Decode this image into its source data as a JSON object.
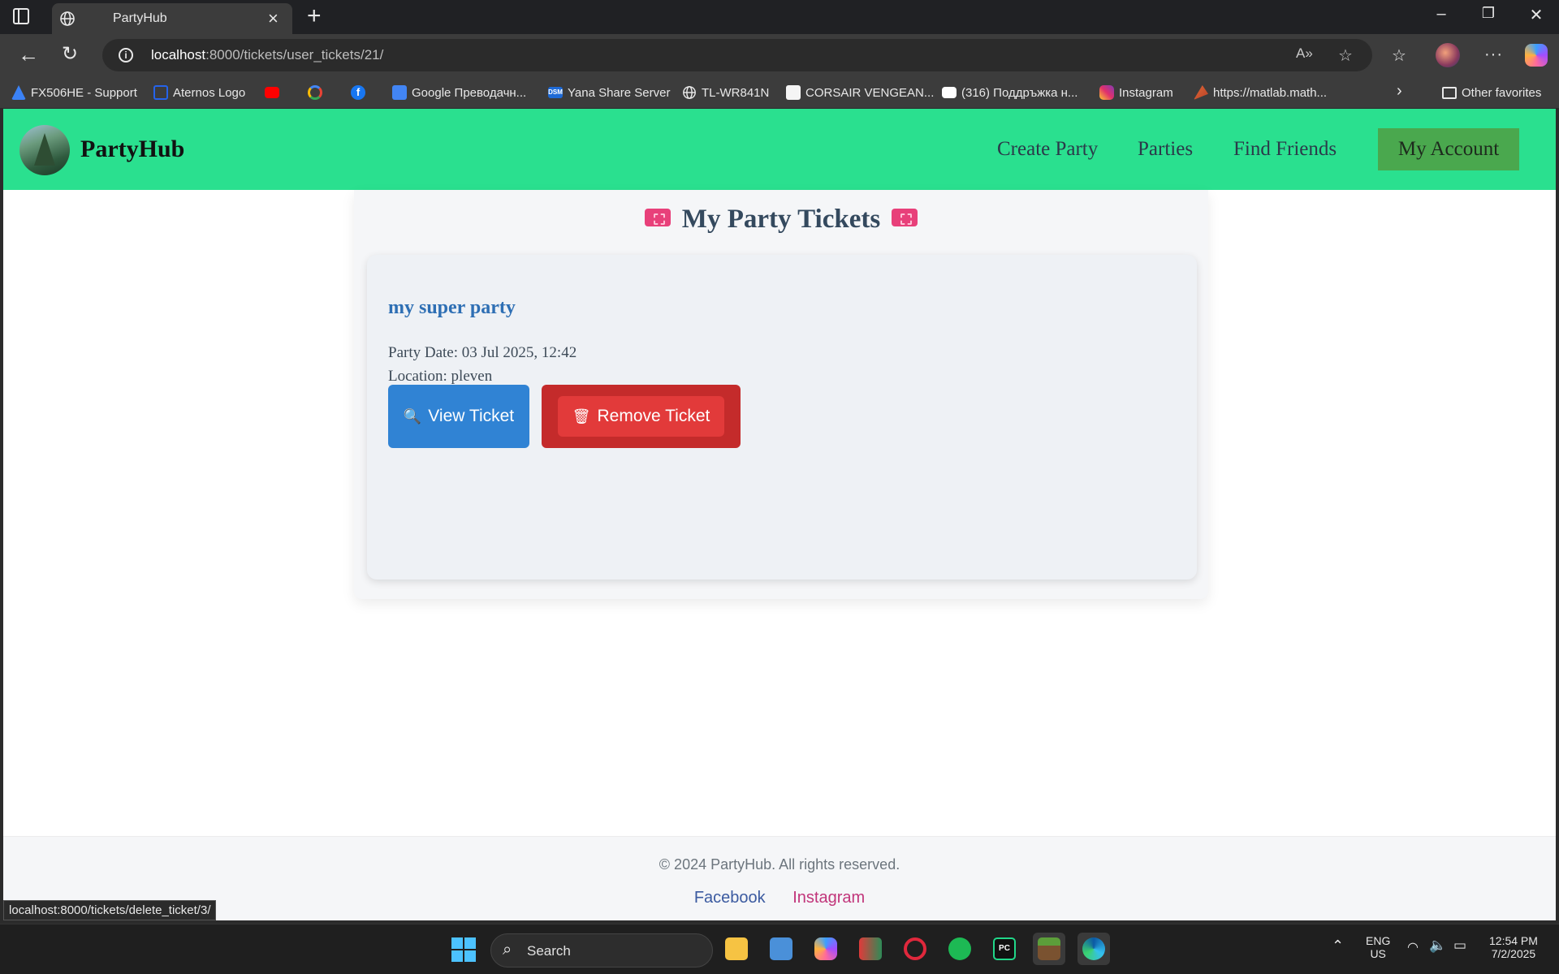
{
  "browser": {
    "tab_title": "PartyHub",
    "url_host": "localhost",
    "url_path": ":8000/tickets/user_tickets/21/",
    "favorites": [
      {
        "label": "FX506HE - Support",
        "icon": "asus-icon",
        "color": "#3b82f6"
      },
      {
        "label": "Aternos Logo",
        "icon": "aternos-icon",
        "color": "#2563eb"
      },
      {
        "label": "",
        "icon": "youtube-icon",
        "color": "#ff0000"
      },
      {
        "label": "",
        "icon": "google-icon",
        "color": "#ffffff"
      },
      {
        "label": "",
        "icon": "facebook-icon",
        "color": "#1877f2"
      },
      {
        "label": "Google Преводачн...",
        "icon": "google-translate-icon",
        "color": "#4285f4"
      },
      {
        "label": "Yana Share Server",
        "icon": "dsm-icon",
        "color": "#1e6ad6"
      },
      {
        "label": "TL-WR841N",
        "icon": "globe-icon",
        "color": "#e8e8e8"
      },
      {
        "label": "CORSAIR VENGEAN...",
        "icon": "corsair-icon",
        "color": "#f5f5f5"
      },
      {
        "label": "(316) Поддръжка н...",
        "icon": "youtube-icon",
        "color": "#ffffff"
      },
      {
        "label": "Instagram",
        "icon": "instagram-icon",
        "color": "#e1306c"
      },
      {
        "label": "https://matlab.math...",
        "icon": "matlab-icon",
        "color": "#e16737"
      }
    ],
    "other_favorites": "Other favorites",
    "status_url": "localhost:8000/tickets/delete_ticket/3/"
  },
  "site": {
    "brand": "PartyHub",
    "nav": {
      "create_party": "Create Party",
      "parties": "Parties",
      "find_friends": "Find Friends",
      "my_account": "My Account"
    },
    "colors": {
      "nav_bg": "#2ae08f",
      "account_btn": "#4aa84e",
      "view_btn": "#3083d4",
      "remove_btn": "#e23a3a",
      "title": "#34495e",
      "ticket_name": "#2e6fb4"
    }
  },
  "main": {
    "title": "My Party Tickets",
    "tickets": [
      {
        "name": "my super party",
        "date": "Party Date: 03 Jul 2025, 12:42",
        "location": "Location: pleven",
        "view_label": "View Ticket",
        "remove_label": "Remove Ticket"
      }
    ]
  },
  "footer": {
    "copyright": "© 2024 PartyHub. All rights reserved.",
    "facebook": "Facebook",
    "instagram": "Instagram"
  },
  "taskbar": {
    "search_placeholder": "Search",
    "lang_top": "ENG",
    "lang_bottom": "US",
    "time": "12:54 PM",
    "date": "7/2/2025"
  }
}
